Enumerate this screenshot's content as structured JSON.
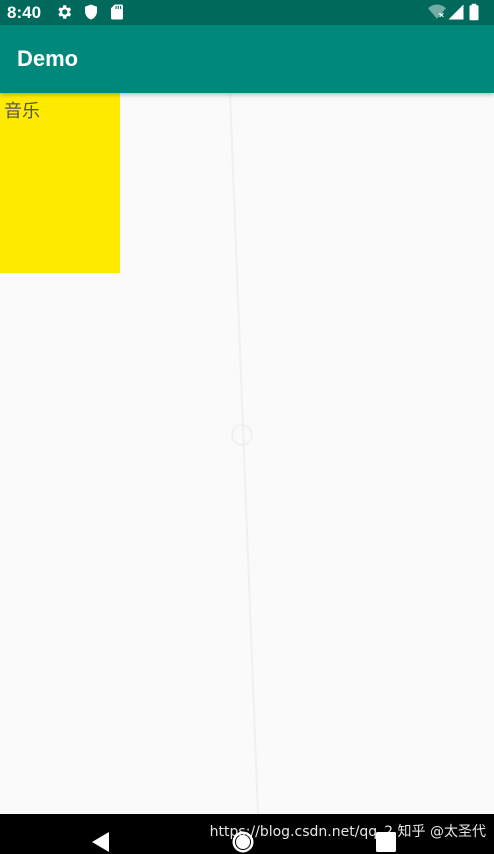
{
  "status_bar": {
    "time": "8:40",
    "icons": [
      "gear-icon",
      "shield-icon",
      "sd-card-icon",
      "wifi-off-icon",
      "signal-icon",
      "battery-icon"
    ]
  },
  "app_bar": {
    "title": "Demo"
  },
  "content": {
    "box_label": "音乐"
  },
  "nav_bar": {
    "icons": [
      "back-icon",
      "home-icon",
      "recents-icon"
    ]
  },
  "watermark": {
    "text": "https://blog.csdn.net/qq_2 知乎 @太圣代"
  },
  "colors": {
    "status_bar": "#00695c",
    "app_bar": "#00897b",
    "box": "#ffeb00",
    "background": "#fafafa"
  }
}
